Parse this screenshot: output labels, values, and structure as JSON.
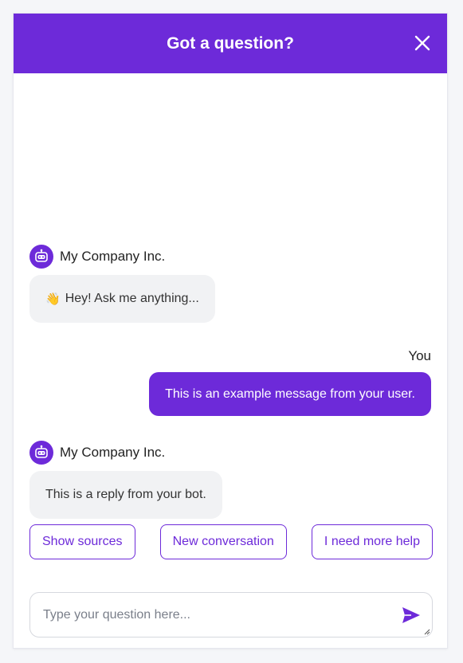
{
  "header": {
    "title": "Got a question?"
  },
  "messages": [
    {
      "type": "bot",
      "sender": "My Company Inc.",
      "emoji": "👋",
      "text": "Hey! Ask me anything..."
    },
    {
      "type": "user",
      "sender": "You",
      "text": "This is an example message from your user."
    },
    {
      "type": "bot",
      "sender": "My Company Inc.",
      "text": "This is a reply from your bot."
    }
  ],
  "actions": [
    {
      "label": "Show sources"
    },
    {
      "label": "New conversation"
    },
    {
      "label": "I need more help"
    }
  ],
  "input": {
    "placeholder": "Type your question here...",
    "value": ""
  },
  "colors": {
    "accent": "#6d2ad9",
    "bot_bubble": "#f1f2f4",
    "background": "#f5f6f9"
  },
  "icons": {
    "close": "close-icon",
    "avatar": "robot-icon",
    "send": "send-icon"
  }
}
